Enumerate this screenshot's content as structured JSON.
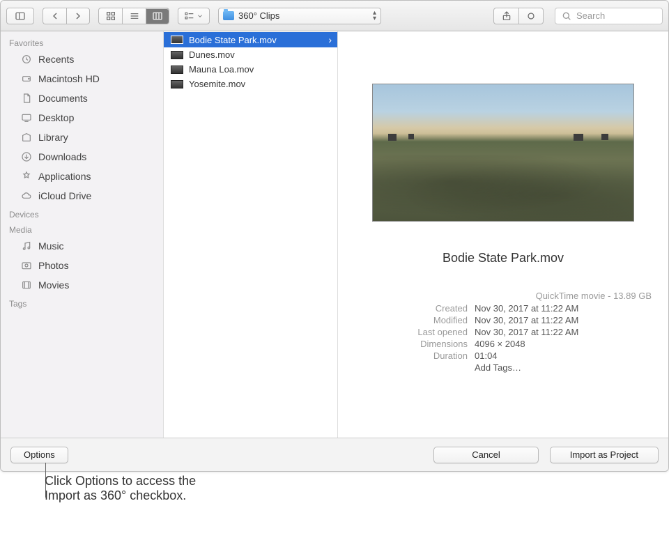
{
  "folder": "360° Clips",
  "search_placeholder": "Search",
  "sidebar": {
    "headings": [
      "Favorites",
      "Devices",
      "Media",
      "Tags"
    ],
    "favorites": [
      {
        "label": "Recents",
        "icon": "clock-icon"
      },
      {
        "label": "Macintosh HD",
        "icon": "disk-icon"
      },
      {
        "label": "Documents",
        "icon": "documents-icon"
      },
      {
        "label": "Desktop",
        "icon": "desktop-icon"
      },
      {
        "label": "Library",
        "icon": "library-icon"
      },
      {
        "label": "Downloads",
        "icon": "downloads-icon"
      },
      {
        "label": "Applications",
        "icon": "applications-icon"
      },
      {
        "label": "iCloud Drive",
        "icon": "cloud-icon"
      }
    ],
    "media": [
      {
        "label": "Music",
        "icon": "music-icon"
      },
      {
        "label": "Photos",
        "icon": "photos-icon"
      },
      {
        "label": "Movies",
        "icon": "movies-icon"
      }
    ]
  },
  "files": [
    {
      "name": "Bodie State Park.mov",
      "selected": true
    },
    {
      "name": "Dunes.mov",
      "selected": false
    },
    {
      "name": "Mauna Loa.mov",
      "selected": false
    },
    {
      "name": "Yosemite.mov",
      "selected": false
    }
  ],
  "preview": {
    "title": "Bodie State Park.mov",
    "type_size": "QuickTime movie - 13.89 GB",
    "rows": [
      {
        "k": "Created",
        "v": "Nov 30, 2017 at 11:22 AM"
      },
      {
        "k": "Modified",
        "v": "Nov 30, 2017 at 11:22 AM"
      },
      {
        "k": "Last opened",
        "v": "Nov 30, 2017 at 11:22 AM"
      },
      {
        "k": "Dimensions",
        "v": "4096 × 2048"
      },
      {
        "k": "Duration",
        "v": "01:04"
      }
    ],
    "add_tags": "Add Tags…"
  },
  "footer": {
    "options": "Options",
    "cancel": "Cancel",
    "import": "Import as Project"
  },
  "callout": "Click Options to access the\nImport as 360° checkbox."
}
